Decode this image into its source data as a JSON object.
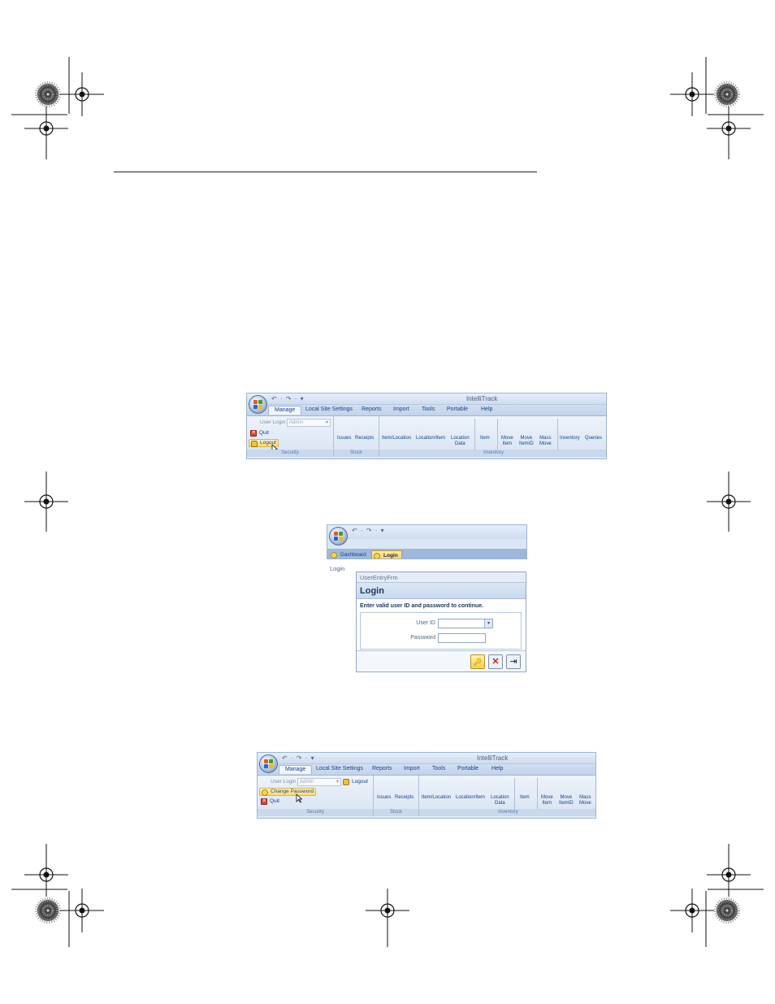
{
  "ribbon1": {
    "window_title": "IntelliTrack",
    "qat": "↶ · ↷ · ▾",
    "tabs": [
      "Manage",
      "Local Site Settings",
      "Reports",
      "Import",
      "Tools",
      "Portable",
      "Help"
    ],
    "security": {
      "user_login_label": "User Login",
      "user_login_value": "Admin",
      "quit_label": "Quit",
      "logout_label": "Logout",
      "group_label": "Security"
    },
    "stock": {
      "commands": [
        "Issues",
        "Receipts"
      ],
      "group_label": "Stock"
    },
    "inventory": {
      "commands": [
        "Item/Location",
        "Location/Item",
        "Location\nData",
        "Item",
        "Move\nItem",
        "Move\nItemID",
        "Mass\nMove",
        "Inventory",
        "Queries"
      ],
      "group_label": "Inventory"
    }
  },
  "login": {
    "qat": "↶ · ↷ · ▾",
    "tabs": [
      "Dashboard",
      "Login"
    ],
    "side_caption": "Login",
    "form_window_title": "UserEntryFrm",
    "heading": "Login",
    "prompt": "Enter valid user ID and password to continue.",
    "user_id_label": "User ID",
    "password_label": "Password",
    "buttons": {
      "ok_glyph": "🔑",
      "cancel_glyph": "✕",
      "exit_glyph": "⇥"
    }
  },
  "ribbon2": {
    "window_title": "IntelliTrack",
    "qat": "↶ · ↷ · ▾",
    "tabs": [
      "Manage",
      "Local Site Settings",
      "Reports",
      "Import",
      "Tools",
      "Portable",
      "Help"
    ],
    "security": {
      "user_login_label": "User Login",
      "user_login_value": "Admin",
      "logout_label": "Logout",
      "change_password_label": "Change Password",
      "quit_label": "Quit",
      "group_label": "Security"
    },
    "stock": {
      "commands": [
        "Issues",
        "Receipts"
      ],
      "group_label": "Stock"
    },
    "inventory": {
      "commands": [
        "Item/Location",
        "Location/Item",
        "Location\nData",
        "Item",
        "Move\nItem",
        "Move\nItemID",
        "Mass\nMove"
      ],
      "group_label": "Inventory"
    }
  }
}
